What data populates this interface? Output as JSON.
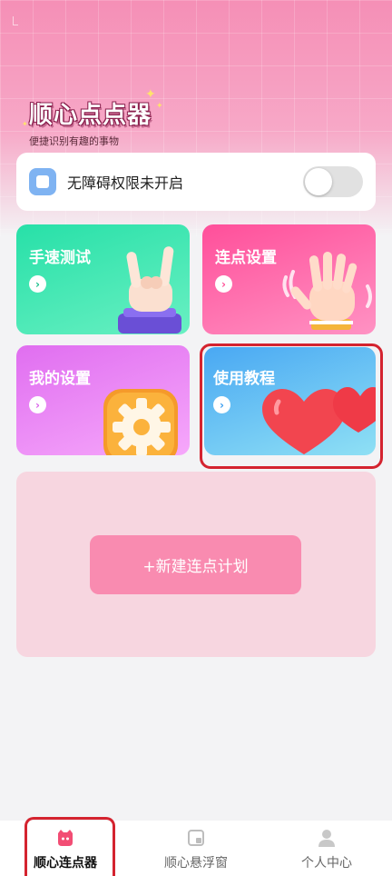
{
  "brand": {
    "title": "顺心点点器",
    "subtitle": "便捷识别有趣的事物"
  },
  "notice": {
    "text": "无障碍权限未开启",
    "toggle_on": false
  },
  "cards": [
    {
      "title": "手速测试",
      "arrow": "›"
    },
    {
      "title": "连点设置",
      "arrow": "›"
    },
    {
      "title": "我的设置",
      "arrow": "›"
    },
    {
      "title": "使用教程",
      "arrow": "›"
    }
  ],
  "plan": {
    "button_label": "+新建连点计划"
  },
  "tabs": [
    {
      "label": "顺心连点器",
      "icon": "cat-face-icon",
      "active": true
    },
    {
      "label": "顺心悬浮窗",
      "icon": "window-icon",
      "active": false
    },
    {
      "label": "个人中心",
      "icon": "person-icon",
      "active": false
    }
  ],
  "colors": {
    "accent": "#f98bb0",
    "highlight": "#d4232f"
  }
}
